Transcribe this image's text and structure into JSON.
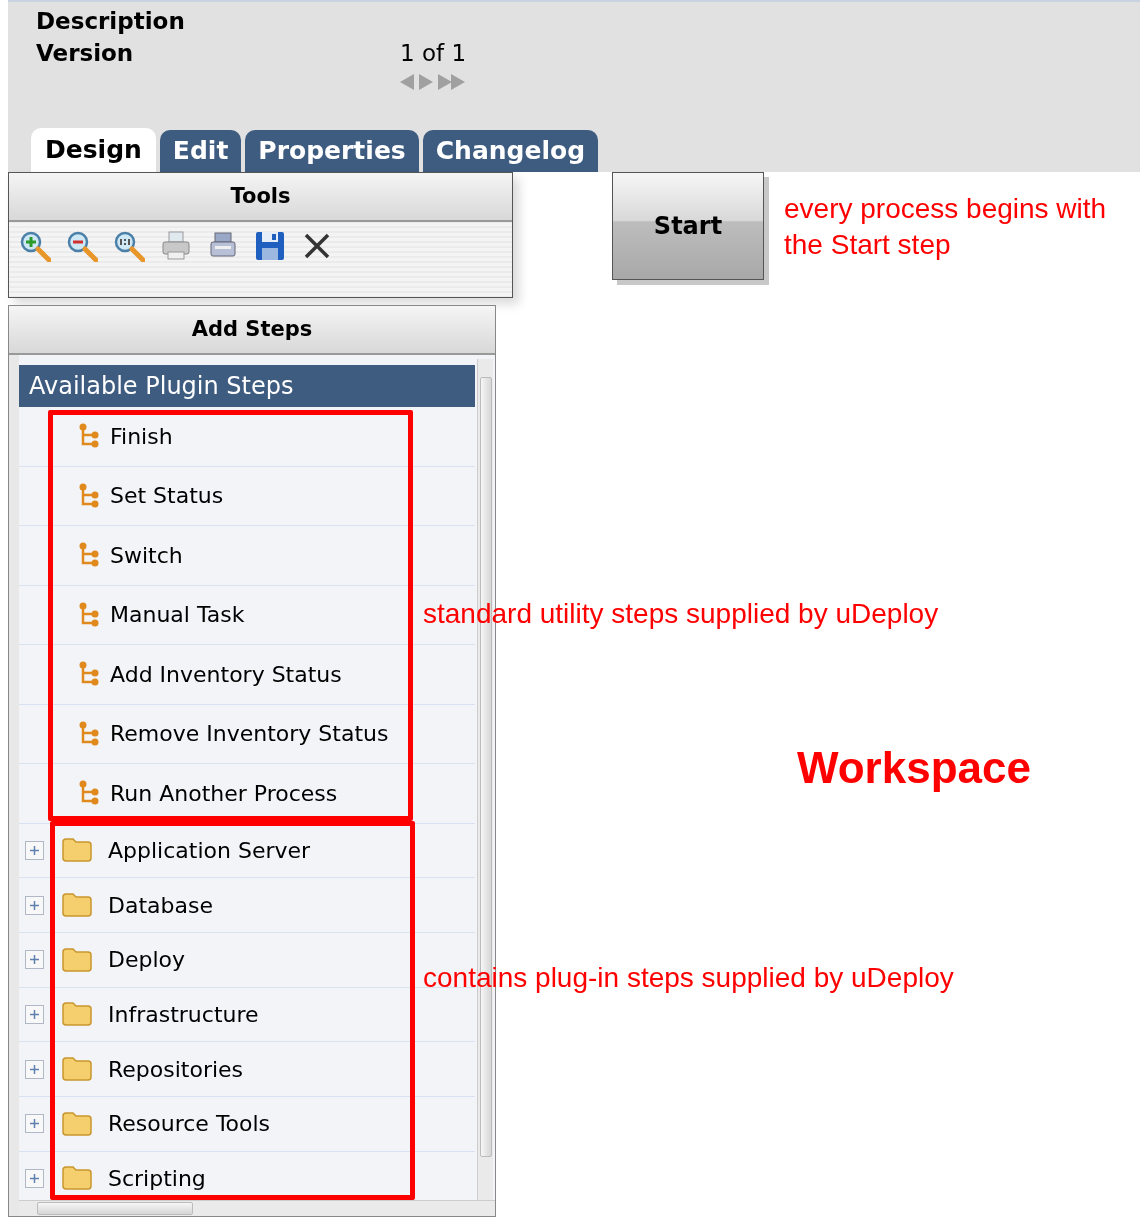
{
  "header": {
    "fields": [
      {
        "label": "Description"
      },
      {
        "label": "Version",
        "value": "1 of 1"
      }
    ]
  },
  "tabs": [
    {
      "label": "Design",
      "selected": true
    },
    {
      "label": "Edit",
      "selected": false
    },
    {
      "label": "Properties",
      "selected": false
    },
    {
      "label": "Changelog",
      "selected": false
    }
  ],
  "tools": {
    "title": "Tools"
  },
  "add_steps": {
    "title": "Add Steps",
    "list_title": "Available Plugin Steps",
    "steps": [
      {
        "label": "Finish"
      },
      {
        "label": "Set Status"
      },
      {
        "label": "Switch"
      },
      {
        "label": "Manual Task"
      },
      {
        "label": "Add Inventory Status"
      },
      {
        "label": "Remove Inventory Status"
      },
      {
        "label": "Run Another Process"
      }
    ],
    "folders": [
      {
        "label": "Application Server",
        "expanded": false
      },
      {
        "label": "Database",
        "expanded": false
      },
      {
        "label": "Deploy",
        "expanded": false
      },
      {
        "label": "Infrastructure",
        "expanded": false
      },
      {
        "label": "Repositories",
        "expanded": false
      },
      {
        "label": "Resource Tools",
        "expanded": false
      },
      {
        "label": "Scripting",
        "expanded": false
      }
    ]
  },
  "workspace": {
    "start_node": "Start",
    "label": "Workspace"
  },
  "annotations": [
    {
      "text": "every process begins with the Start step"
    },
    {
      "text": "standard utility steps supplied by uDeploy"
    },
    {
      "text": "contains plug-in steps supplied by uDeploy"
    }
  ]
}
